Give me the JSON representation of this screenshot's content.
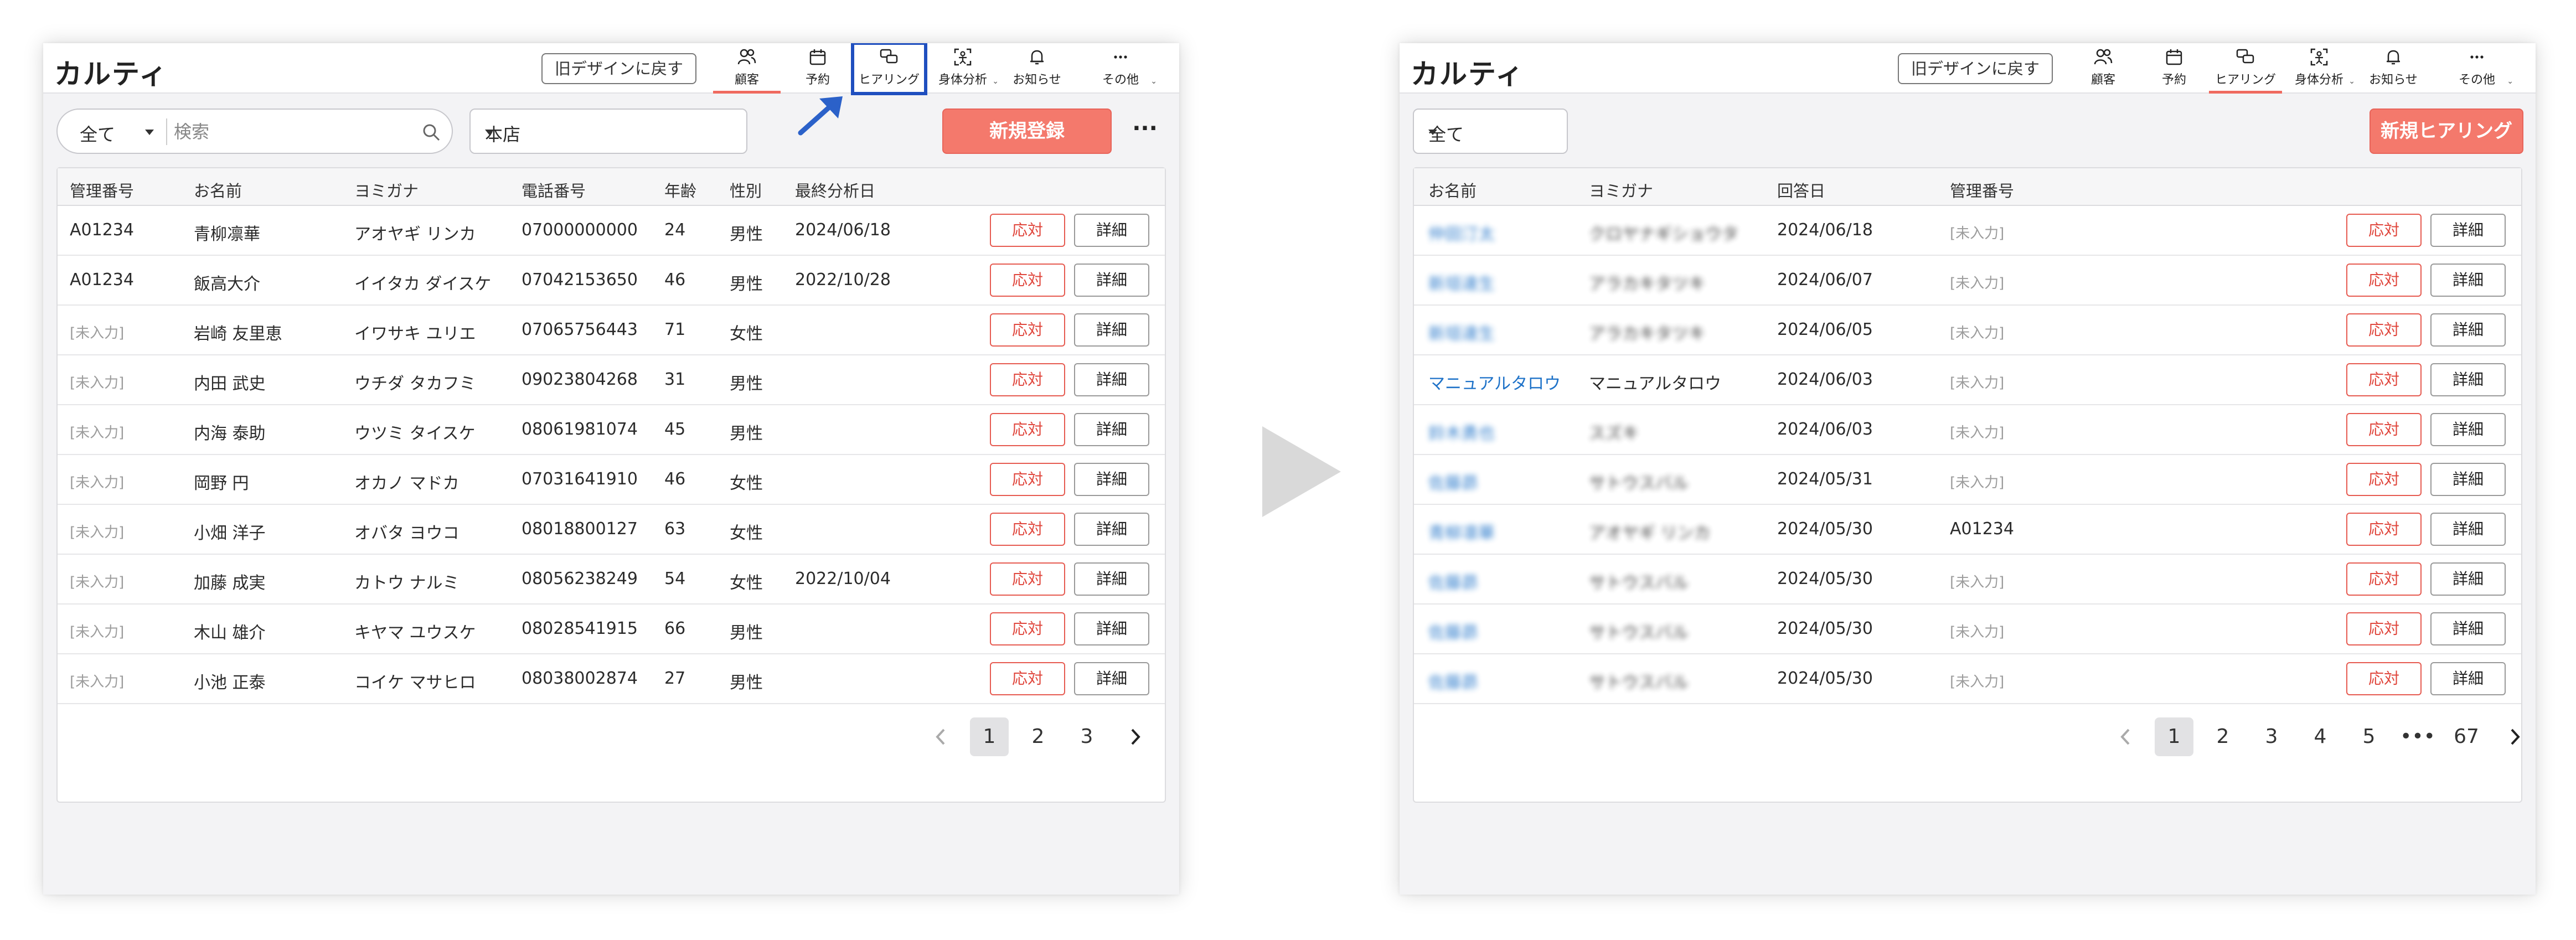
{
  "left": {
    "logo": "カルティ",
    "old_design_button": "旧デザインに戻す",
    "nav": [
      {
        "label": "顧客",
        "icon": "customers-icon"
      },
      {
        "label": "予約",
        "icon": "calendar-icon"
      },
      {
        "label": "ヒアリング",
        "icon": "hearing-icon"
      },
      {
        "label": "身体分析",
        "icon": "body-analysis-icon"
      },
      {
        "label": "お知らせ",
        "icon": "bell-icon"
      },
      {
        "label": "その他",
        "icon": "more-icon"
      }
    ],
    "filter_label": "全て",
    "search_placeholder": "検索",
    "store_label": "本店",
    "primary_button": "新規登録",
    "more_button": "···",
    "columns": [
      "管理番号",
      "お名前",
      "ヨミガナ",
      "電話番号",
      "年齢",
      "性別",
      "最終分析日"
    ],
    "rows": [
      {
        "id": "A01234",
        "id_blank": false,
        "name": "青柳凛華",
        "kana": "アオヤギ リンカ",
        "phone": "07000000000",
        "age": "24",
        "gender": "男性",
        "date": "2024/06/18"
      },
      {
        "id": "A01234",
        "id_blank": false,
        "name": "飯高大介",
        "kana": "イイタカ ダイスケ",
        "phone": "07042153650",
        "age": "46",
        "gender": "男性",
        "date": "2022/10/28"
      },
      {
        "id": "[未入力]",
        "id_blank": true,
        "name": "岩崎 友里恵",
        "kana": "イワサキ ユリエ",
        "phone": "07065756443",
        "age": "71",
        "gender": "女性",
        "date": ""
      },
      {
        "id": "[未入力]",
        "id_blank": true,
        "name": "内田 武史",
        "kana": "ウチダ タカフミ",
        "phone": "09023804268",
        "age": "31",
        "gender": "男性",
        "date": ""
      },
      {
        "id": "[未入力]",
        "id_blank": true,
        "name": "内海 泰助",
        "kana": "ウツミ タイスケ",
        "phone": "08061981074",
        "age": "45",
        "gender": "男性",
        "date": ""
      },
      {
        "id": "[未入力]",
        "id_blank": true,
        "name": "岡野 円",
        "kana": "オカノ マドカ",
        "phone": "07031641910",
        "age": "46",
        "gender": "女性",
        "date": ""
      },
      {
        "id": "[未入力]",
        "id_blank": true,
        "name": "小畑 洋子",
        "kana": "オバタ ヨウコ",
        "phone": "08018800127",
        "age": "63",
        "gender": "女性",
        "date": ""
      },
      {
        "id": "[未入力]",
        "id_blank": true,
        "name": "加藤 成実",
        "kana": "カトウ ナルミ",
        "phone": "08056238249",
        "age": "54",
        "gender": "女性",
        "date": "2022/10/04"
      },
      {
        "id": "[未入力]",
        "id_blank": true,
        "name": "木山 雄介",
        "kana": "キヤマ ユウスケ",
        "phone": "08028541915",
        "age": "66",
        "gender": "男性",
        "date": ""
      },
      {
        "id": "[未入力]",
        "id_blank": true,
        "name": "小池 正泰",
        "kana": "コイケ マサヒロ",
        "phone": "08038002874",
        "age": "27",
        "gender": "男性",
        "date": ""
      }
    ],
    "respond_label": "応対",
    "detail_label": "詳細",
    "pages": [
      "1",
      "2",
      "3"
    ]
  },
  "right": {
    "logo": "カルティ",
    "old_design_button": "旧デザインに戻す",
    "nav": [
      {
        "label": "顧客",
        "icon": "customers-icon"
      },
      {
        "label": "予約",
        "icon": "calendar-icon"
      },
      {
        "label": "ヒアリング",
        "icon": "hearing-icon"
      },
      {
        "label": "身体分析",
        "icon": "body-analysis-icon"
      },
      {
        "label": "お知らせ",
        "icon": "bell-icon"
      },
      {
        "label": "その他",
        "icon": "more-icon"
      }
    ],
    "filter_label": "全て",
    "primary_button": "新規ヒアリング",
    "columns": [
      "お名前",
      "ヨミガナ",
      "回答日",
      "管理番号"
    ],
    "rows": [
      {
        "name": "仲田汀太",
        "kana": "クロヤナギショウタ",
        "date": "2024/06/18",
        "id": "[未入力]",
        "blurred": true,
        "id_blank": true
      },
      {
        "name": "新垣達生",
        "kana": "アラカキタツキ",
        "date": "2024/06/07",
        "id": "[未入力]",
        "blurred": true,
        "id_blank": true
      },
      {
        "name": "新垣達生",
        "kana": "アラカキタツキ",
        "date": "2024/06/05",
        "id": "[未入力]",
        "blurred": true,
        "id_blank": true
      },
      {
        "name": "マニュアルタロウ",
        "kana": "マニュアルタロウ",
        "date": "2024/06/03",
        "id": "[未入力]",
        "blurred": false,
        "id_blank": true
      },
      {
        "name": "鈴木勇也",
        "kana": "スズキ",
        "date": "2024/06/03",
        "id": "[未入力]",
        "blurred": true,
        "id_blank": true
      },
      {
        "name": "佐藤昴",
        "kana": "サトウスバル",
        "date": "2024/05/31",
        "id": "[未入力]",
        "blurred": true,
        "id_blank": true
      },
      {
        "name": "青柳凛華",
        "kana": "アオヤギ リンカ",
        "date": "2024/05/30",
        "id": "A01234",
        "blurred": true,
        "id_blank": false
      },
      {
        "name": "佐藤昴",
        "kana": "サトウスバル",
        "date": "2024/05/30",
        "id": "[未入力]",
        "blurred": true,
        "id_blank": true
      },
      {
        "name": "佐藤昴",
        "kana": "サトウスバル",
        "date": "2024/05/30",
        "id": "[未入力]",
        "blurred": true,
        "id_blank": true
      },
      {
        "name": "佐藤昴",
        "kana": "サトウスバル",
        "date": "2024/05/30",
        "id": "[未入力]",
        "blurred": true,
        "id_blank": true
      }
    ],
    "respond_label": "応対",
    "detail_label": "詳細",
    "pages": [
      "1",
      "2",
      "3",
      "4",
      "5",
      "•••",
      "67"
    ]
  },
  "colors": {
    "accent": "#f4796c",
    "danger_text": "#e0463c",
    "link": "#1e72c8",
    "highlight_box": "#1f4fbf"
  }
}
